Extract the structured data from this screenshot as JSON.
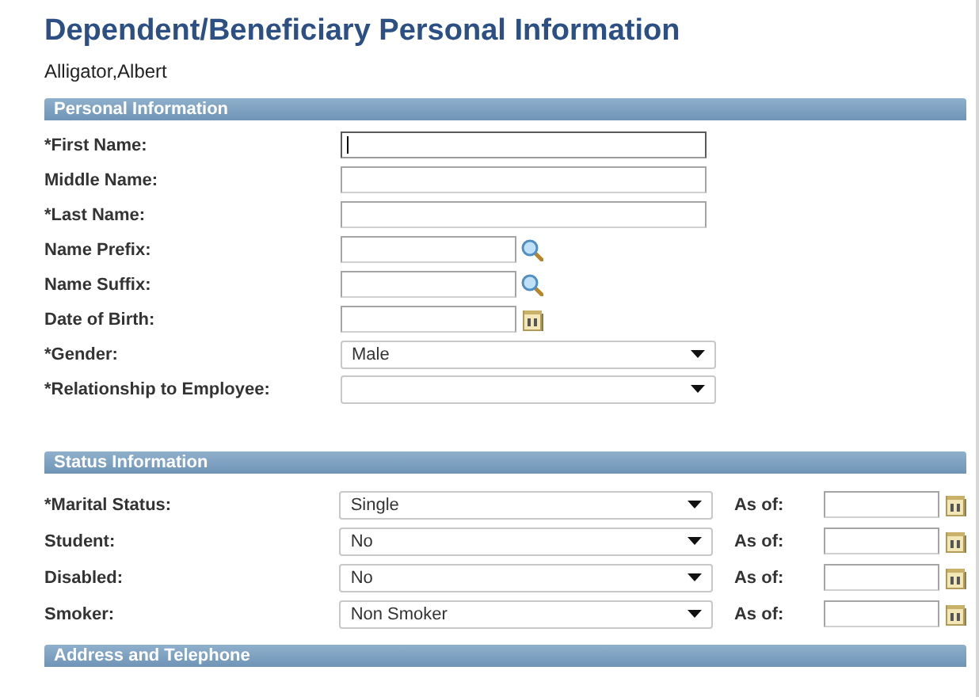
{
  "page": {
    "title": "Dependent/Beneficiary Personal Information",
    "subtitle": "Alligator,Albert"
  },
  "personal_information": {
    "heading": "Personal Information",
    "fields": [
      {
        "label": "*First Name:",
        "kind": "text",
        "focused": true
      },
      {
        "label": "Middle Name:",
        "kind": "text",
        "focused": false
      },
      {
        "label": "*Last Name:",
        "kind": "text",
        "focused": false
      },
      {
        "label": "Name Prefix:",
        "kind": "lookup",
        "focused": false
      },
      {
        "label": "Name Suffix:",
        "kind": "lookup",
        "focused": false
      },
      {
        "label": "Date of Birth:",
        "kind": "date",
        "focused": false
      },
      {
        "label": "*Gender:",
        "kind": "select",
        "value": "Male",
        "focused": false
      },
      {
        "label": "*Relationship to Employee:",
        "kind": "select",
        "focused": false
      }
    ]
  },
  "status_information": {
    "heading": "Status Information",
    "rows": [
      {
        "label": "*Marital Status:",
        "value": "Single",
        "as_of_label": "As of:"
      },
      {
        "label": "Student:",
        "value": "No",
        "as_of_label": "As of:"
      },
      {
        "label": "Disabled:",
        "value": "No",
        "as_of_label": "As of:"
      },
      {
        "label": "Smoker:",
        "value": "Non Smoker",
        "as_of_label": "As of:"
      }
    ]
  },
  "address_and_telephone": {
    "heading": "Address and Telephone"
  }
}
